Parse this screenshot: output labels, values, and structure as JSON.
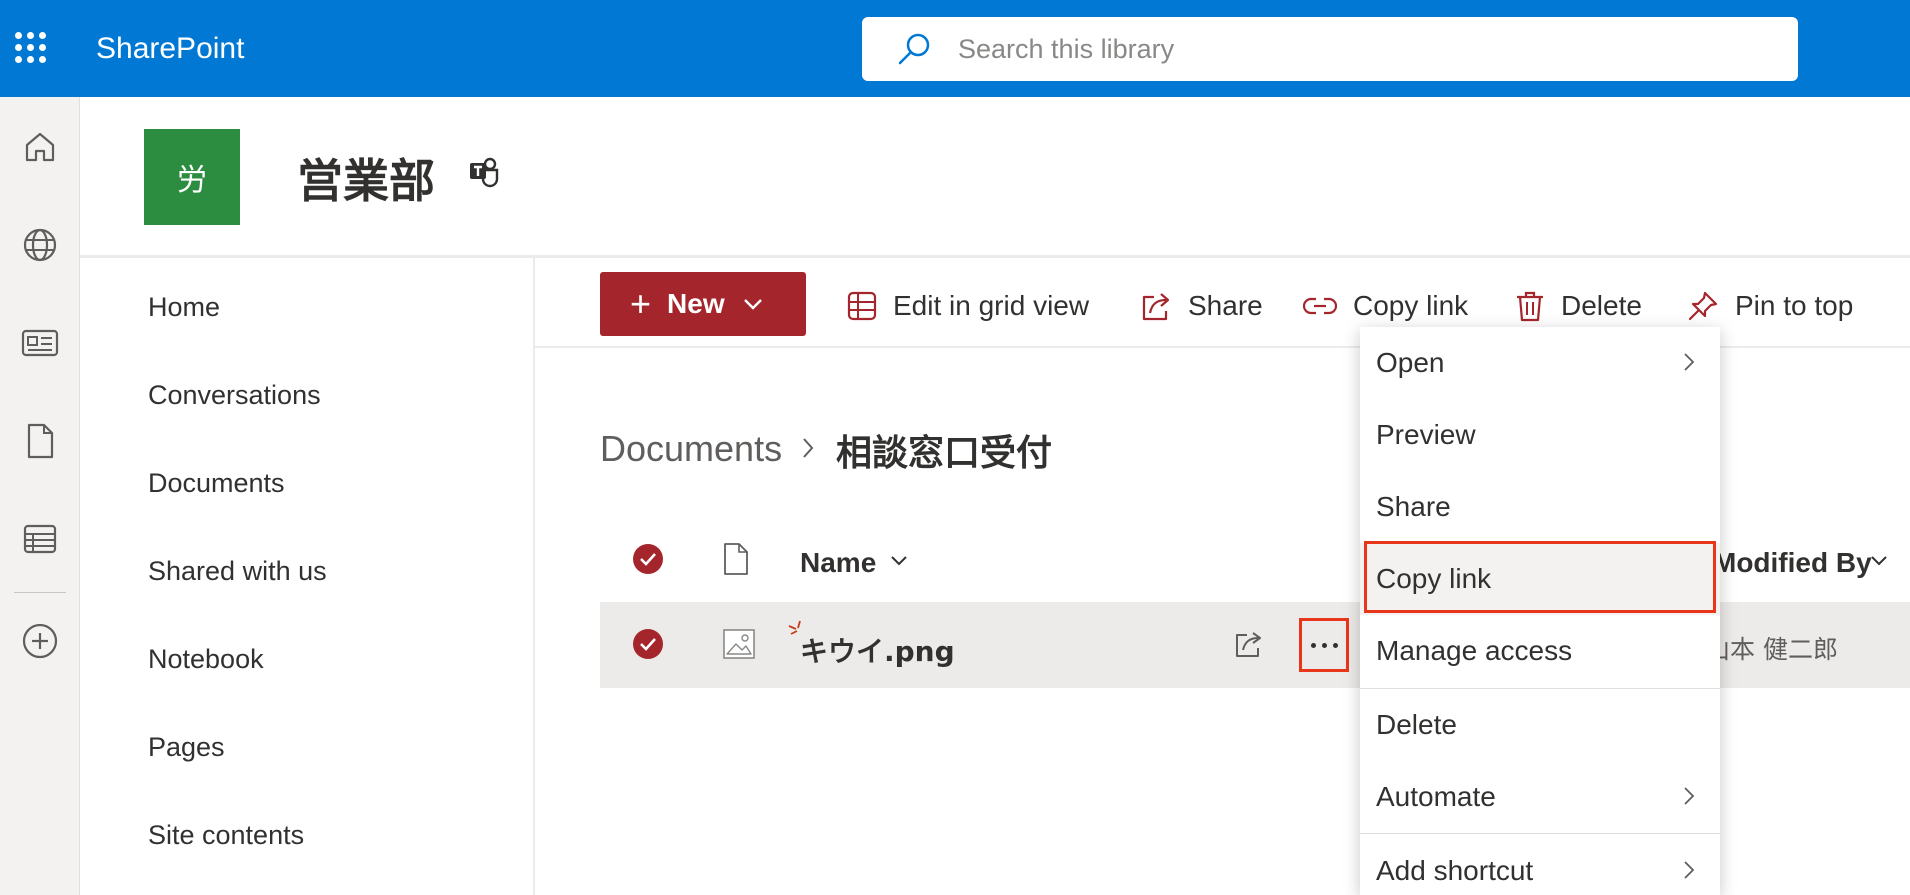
{
  "suite_bar": {
    "app_name": "SharePoint",
    "search_placeholder": "Search this library",
    "icons": [
      "app-launcher-icon",
      "search-icon"
    ]
  },
  "app_bar": {
    "icons": [
      "home-icon",
      "globe-icon",
      "news-icon",
      "file-icon",
      "list-icon",
      "add-icon"
    ]
  },
  "site": {
    "logo_text": "労",
    "title": "営業部",
    "logo_color": "#2c8c3f"
  },
  "site_nav": {
    "items": [
      {
        "label": "Home"
      },
      {
        "label": "Conversations"
      },
      {
        "label": "Documents"
      },
      {
        "label": "Shared with us"
      },
      {
        "label": "Notebook"
      },
      {
        "label": "Pages"
      },
      {
        "label": "Site contents"
      }
    ]
  },
  "command_bar": {
    "new_label": "New",
    "edit_grid_label": "Edit in grid view",
    "share_label": "Share",
    "copy_link_label": "Copy link",
    "delete_label": "Delete",
    "pin_label": "Pin to top",
    "accent_color": "#a4262c"
  },
  "breadcrumb": {
    "root": "Documents",
    "current": "相談窓口受付"
  },
  "list": {
    "columns": {
      "name": "Name",
      "modified_by": "Modified By"
    },
    "rows": [
      {
        "name": "キウイ.png",
        "modified_by": "山本 健二郎",
        "selected": true
      }
    ]
  },
  "context_menu": {
    "items": [
      {
        "label": "Open",
        "submenu": true
      },
      {
        "label": "Preview",
        "submenu": false
      },
      {
        "label": "Share",
        "submenu": false
      },
      {
        "label": "Copy link",
        "submenu": false,
        "highlighted": true
      },
      {
        "label": "Manage access",
        "submenu": false
      },
      {
        "label": "Delete",
        "submenu": false
      },
      {
        "label": "Automate",
        "submenu": true
      },
      {
        "label": "Add shortcut",
        "submenu": true
      }
    ],
    "highlight_color": "#e8361b"
  }
}
